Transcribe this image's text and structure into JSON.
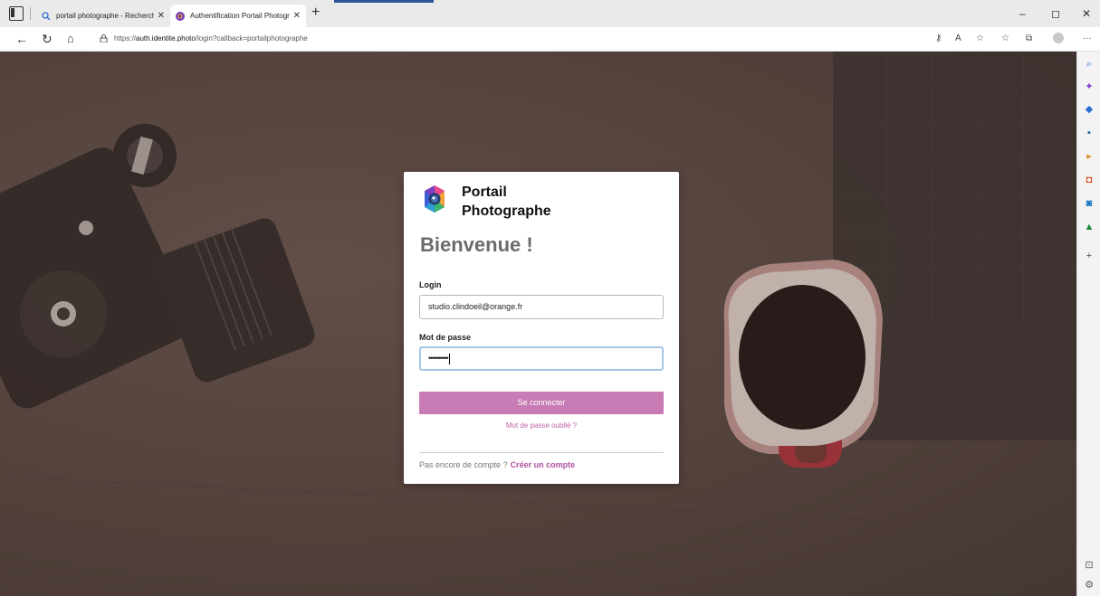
{
  "browser": {
    "tabs": [
      {
        "title": "portail photographe - Recherche",
        "active": false
      },
      {
        "title": "Authentification Portail Photographe",
        "active": true
      }
    ],
    "url_prefix": "https://",
    "url_host": "auth.identite.photo",
    "url_path": "/login?callback=portailphotographe"
  },
  "brand": {
    "line1": "Portail",
    "line2": "Photographe"
  },
  "login_form": {
    "welcome": "Bienvenue !",
    "login_label": "Login",
    "login_value": "studio.clindoeil@orange.fr",
    "password_label": "Mot de passe",
    "password_mask": "••••••••••",
    "submit_label": "Se connecter",
    "forgot_label": "Mot de passe oublié ?",
    "no_account_text": "Pas encore de compte ?",
    "create_account_label": "Créer un compte"
  },
  "colors": {
    "accent": "#c87bb4",
    "link": "#b050a0",
    "focus": "#a7c6e8"
  }
}
